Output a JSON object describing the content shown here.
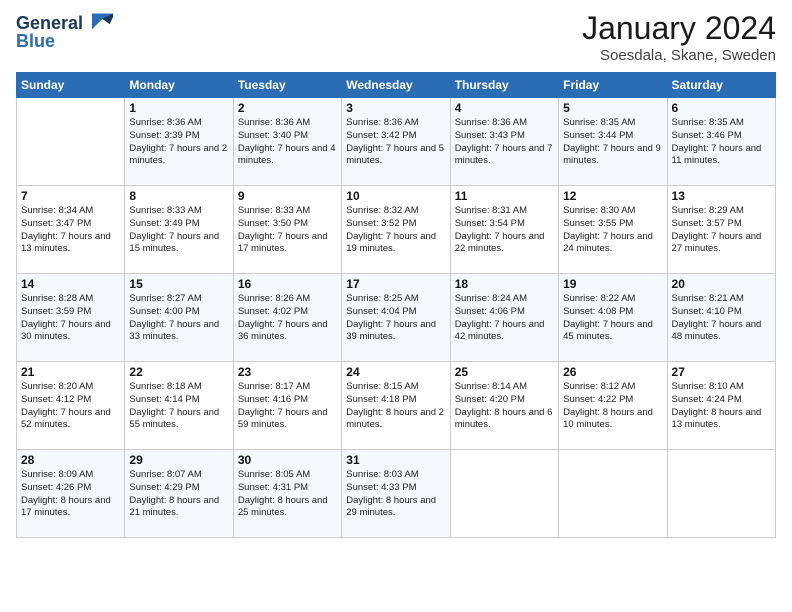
{
  "logo": {
    "line1": "General",
    "line2": "Blue"
  },
  "title": "January 2024",
  "location": "Soesdala, Skane, Sweden",
  "days_of_week": [
    "Sunday",
    "Monday",
    "Tuesday",
    "Wednesday",
    "Thursday",
    "Friday",
    "Saturday"
  ],
  "weeks": [
    [
      {
        "day": "",
        "sunrise": "",
        "sunset": "",
        "daylight": ""
      },
      {
        "day": "1",
        "sunrise": "Sunrise: 8:36 AM",
        "sunset": "Sunset: 3:39 PM",
        "daylight": "Daylight: 7 hours and 2 minutes."
      },
      {
        "day": "2",
        "sunrise": "Sunrise: 8:36 AM",
        "sunset": "Sunset: 3:40 PM",
        "daylight": "Daylight: 7 hours and 4 minutes."
      },
      {
        "day": "3",
        "sunrise": "Sunrise: 8:36 AM",
        "sunset": "Sunset: 3:42 PM",
        "daylight": "Daylight: 7 hours and 5 minutes."
      },
      {
        "day": "4",
        "sunrise": "Sunrise: 8:36 AM",
        "sunset": "Sunset: 3:43 PM",
        "daylight": "Daylight: 7 hours and 7 minutes."
      },
      {
        "day": "5",
        "sunrise": "Sunrise: 8:35 AM",
        "sunset": "Sunset: 3:44 PM",
        "daylight": "Daylight: 7 hours and 9 minutes."
      },
      {
        "day": "6",
        "sunrise": "Sunrise: 8:35 AM",
        "sunset": "Sunset: 3:46 PM",
        "daylight": "Daylight: 7 hours and 11 minutes."
      }
    ],
    [
      {
        "day": "7",
        "sunrise": "Sunrise: 8:34 AM",
        "sunset": "Sunset: 3:47 PM",
        "daylight": "Daylight: 7 hours and 13 minutes."
      },
      {
        "day": "8",
        "sunrise": "Sunrise: 8:33 AM",
        "sunset": "Sunset: 3:49 PM",
        "daylight": "Daylight: 7 hours and 15 minutes."
      },
      {
        "day": "9",
        "sunrise": "Sunrise: 8:33 AM",
        "sunset": "Sunset: 3:50 PM",
        "daylight": "Daylight: 7 hours and 17 minutes."
      },
      {
        "day": "10",
        "sunrise": "Sunrise: 8:32 AM",
        "sunset": "Sunset: 3:52 PM",
        "daylight": "Daylight: 7 hours and 19 minutes."
      },
      {
        "day": "11",
        "sunrise": "Sunrise: 8:31 AM",
        "sunset": "Sunset: 3:54 PM",
        "daylight": "Daylight: 7 hours and 22 minutes."
      },
      {
        "day": "12",
        "sunrise": "Sunrise: 8:30 AM",
        "sunset": "Sunset: 3:55 PM",
        "daylight": "Daylight: 7 hours and 24 minutes."
      },
      {
        "day": "13",
        "sunrise": "Sunrise: 8:29 AM",
        "sunset": "Sunset: 3:57 PM",
        "daylight": "Daylight: 7 hours and 27 minutes."
      }
    ],
    [
      {
        "day": "14",
        "sunrise": "Sunrise: 8:28 AM",
        "sunset": "Sunset: 3:59 PM",
        "daylight": "Daylight: 7 hours and 30 minutes."
      },
      {
        "day": "15",
        "sunrise": "Sunrise: 8:27 AM",
        "sunset": "Sunset: 4:00 PM",
        "daylight": "Daylight: 7 hours and 33 minutes."
      },
      {
        "day": "16",
        "sunrise": "Sunrise: 8:26 AM",
        "sunset": "Sunset: 4:02 PM",
        "daylight": "Daylight: 7 hours and 36 minutes."
      },
      {
        "day": "17",
        "sunrise": "Sunrise: 8:25 AM",
        "sunset": "Sunset: 4:04 PM",
        "daylight": "Daylight: 7 hours and 39 minutes."
      },
      {
        "day": "18",
        "sunrise": "Sunrise: 8:24 AM",
        "sunset": "Sunset: 4:06 PM",
        "daylight": "Daylight: 7 hours and 42 minutes."
      },
      {
        "day": "19",
        "sunrise": "Sunrise: 8:22 AM",
        "sunset": "Sunset: 4:08 PM",
        "daylight": "Daylight: 7 hours and 45 minutes."
      },
      {
        "day": "20",
        "sunrise": "Sunrise: 8:21 AM",
        "sunset": "Sunset: 4:10 PM",
        "daylight": "Daylight: 7 hours and 48 minutes."
      }
    ],
    [
      {
        "day": "21",
        "sunrise": "Sunrise: 8:20 AM",
        "sunset": "Sunset: 4:12 PM",
        "daylight": "Daylight: 7 hours and 52 minutes."
      },
      {
        "day": "22",
        "sunrise": "Sunrise: 8:18 AM",
        "sunset": "Sunset: 4:14 PM",
        "daylight": "Daylight: 7 hours and 55 minutes."
      },
      {
        "day": "23",
        "sunrise": "Sunrise: 8:17 AM",
        "sunset": "Sunset: 4:16 PM",
        "daylight": "Daylight: 7 hours and 59 minutes."
      },
      {
        "day": "24",
        "sunrise": "Sunrise: 8:15 AM",
        "sunset": "Sunset: 4:18 PM",
        "daylight": "Daylight: 8 hours and 2 minutes."
      },
      {
        "day": "25",
        "sunrise": "Sunrise: 8:14 AM",
        "sunset": "Sunset: 4:20 PM",
        "daylight": "Daylight: 8 hours and 6 minutes."
      },
      {
        "day": "26",
        "sunrise": "Sunrise: 8:12 AM",
        "sunset": "Sunset: 4:22 PM",
        "daylight": "Daylight: 8 hours and 10 minutes."
      },
      {
        "day": "27",
        "sunrise": "Sunrise: 8:10 AM",
        "sunset": "Sunset: 4:24 PM",
        "daylight": "Daylight: 8 hours and 13 minutes."
      }
    ],
    [
      {
        "day": "28",
        "sunrise": "Sunrise: 8:09 AM",
        "sunset": "Sunset: 4:26 PM",
        "daylight": "Daylight: 8 hours and 17 minutes."
      },
      {
        "day": "29",
        "sunrise": "Sunrise: 8:07 AM",
        "sunset": "Sunset: 4:29 PM",
        "daylight": "Daylight: 8 hours and 21 minutes."
      },
      {
        "day": "30",
        "sunrise": "Sunrise: 8:05 AM",
        "sunset": "Sunset: 4:31 PM",
        "daylight": "Daylight: 8 hours and 25 minutes."
      },
      {
        "day": "31",
        "sunrise": "Sunrise: 8:03 AM",
        "sunset": "Sunset: 4:33 PM",
        "daylight": "Daylight: 8 hours and 29 minutes."
      },
      {
        "day": "",
        "sunrise": "",
        "sunset": "",
        "daylight": ""
      },
      {
        "day": "",
        "sunrise": "",
        "sunset": "",
        "daylight": ""
      },
      {
        "day": "",
        "sunrise": "",
        "sunset": "",
        "daylight": ""
      }
    ]
  ]
}
